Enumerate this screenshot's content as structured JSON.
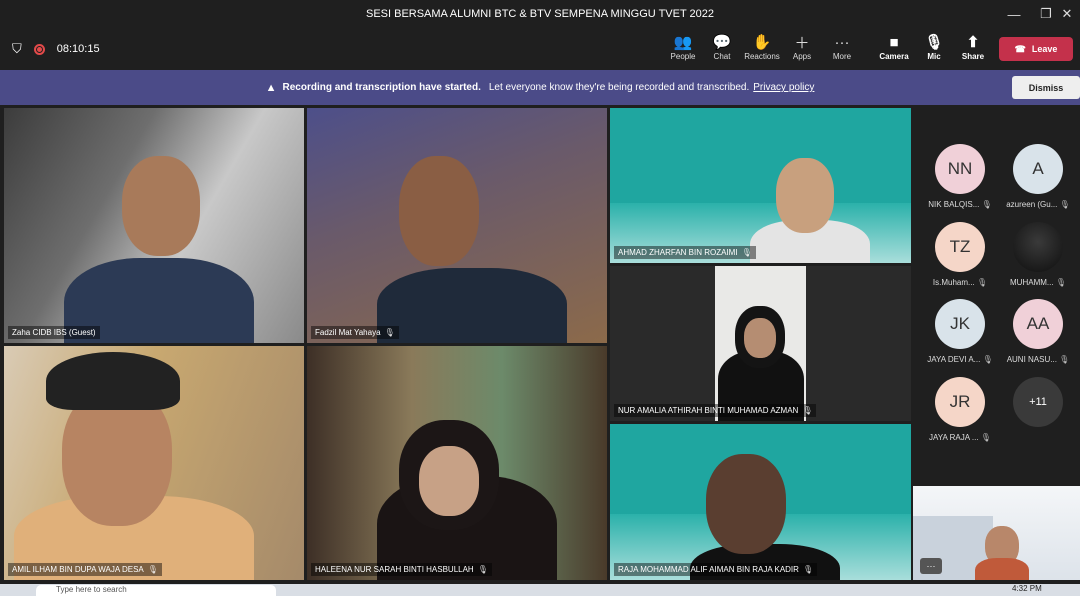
{
  "window": {
    "title": "SESI BERSAMA ALUMNI BTC & BTV SEMPENA MINGGU TVET 2022"
  },
  "toolbar": {
    "timer": "08:10:15",
    "people": "People",
    "chat": "Chat",
    "reactions": "Reactions",
    "apps": "Apps",
    "more": "More",
    "camera": "Camera",
    "mic": "Mic",
    "share": "Share",
    "leave": "Leave"
  },
  "banner": {
    "bold": "Recording and transcription have started.",
    "text": "Let everyone know they're being recorded and transcribed.",
    "link": "Privacy policy",
    "dismiss": "Dismiss"
  },
  "tiles": [
    {
      "name": "Zaha CIDB IBS (Guest)"
    },
    {
      "name": "Fadzil Mat Yahaya"
    },
    {
      "name": "AHMAD ZHARFAN BIN ROZAIMI"
    },
    {
      "name": "NUR AMALIA ATHIRAH BINTI MUHAMAD AZMAN"
    },
    {
      "name": "AMIL ILHAM BIN DUPA WAJA DESA"
    },
    {
      "name": "HALEENA NUR SARAH BINTI HASBULLAH"
    },
    {
      "name": "RAJA MOHAMMAD ALIF AIMAN BIN RAJA KADIR"
    }
  ],
  "participants": [
    {
      "initials": "NN",
      "name": "NIK BALQIS...",
      "color": "#f0d0d8"
    },
    {
      "initials": "A",
      "name": "azureen (Gu...",
      "color": "#d9e3ea"
    },
    {
      "initials": "TZ",
      "name": "Is.Muham...",
      "color": "#f5d6c8"
    },
    {
      "initials": "",
      "name": "MUHAMM...",
      "color": "#1a1a1a"
    },
    {
      "initials": "JK",
      "name": "JAYA DEVI A...",
      "color": "#d9e3ea"
    },
    {
      "initials": "AA",
      "name": "AUNI NASU...",
      "color": "#f0d0d8"
    },
    {
      "initials": "JR",
      "name": "JAYA RAJA ...",
      "color": "#f5d6c8"
    },
    {
      "initials": "+11",
      "name": "",
      "color": "#3a3a3a"
    }
  ],
  "taskbar": {
    "search": "Type here to search",
    "time": "4:32 PM"
  },
  "colors": {
    "banner": "#4b4b88",
    "leave": "#c4314b"
  }
}
